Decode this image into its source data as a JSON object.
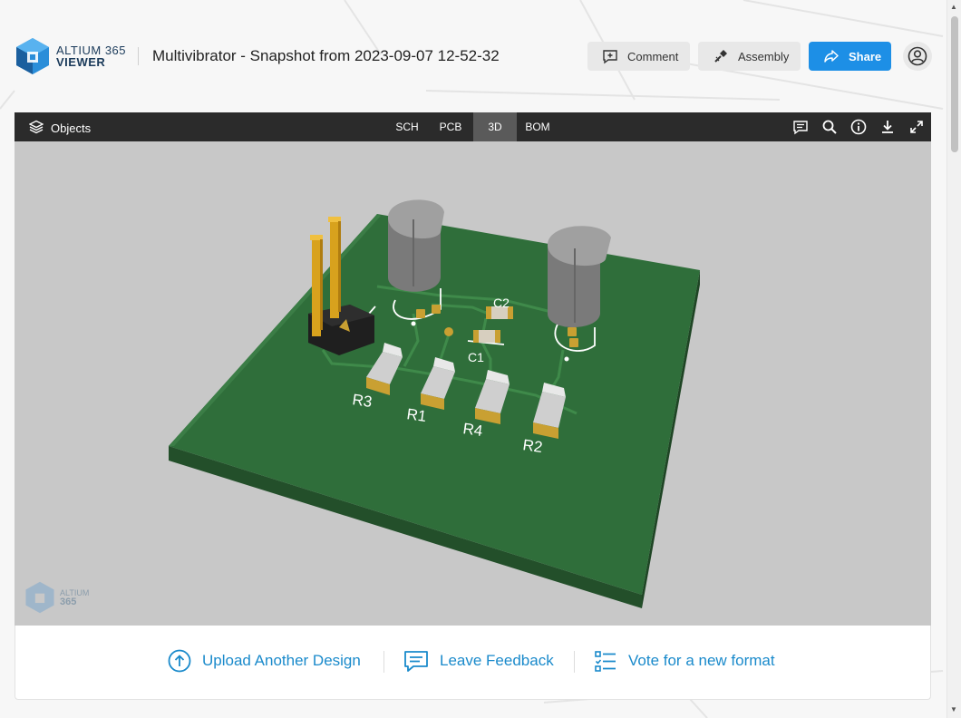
{
  "app": {
    "logo_line1": "ALTIUM 365",
    "logo_line2": "VIEWER"
  },
  "document": {
    "title": "Multivibrator - Snapshot from 2023-09-07 12-52-32"
  },
  "header": {
    "comment_label": "Comment",
    "assembly_label": "Assembly",
    "share_label": "Share"
  },
  "viewer": {
    "objects_label": "Objects",
    "tabs": [
      {
        "label": "SCH",
        "active": false
      },
      {
        "label": "PCB",
        "active": false
      },
      {
        "label": "3D",
        "active": true
      },
      {
        "label": "BOM",
        "active": false
      }
    ],
    "tool_icons": [
      "comments-icon",
      "search-icon",
      "info-icon",
      "download-icon",
      "fullscreen-icon"
    ],
    "watermark_line1": "ALTIUM",
    "watermark_line2": "365"
  },
  "board": {
    "labels": [
      "C2",
      "C1",
      "R3",
      "R1",
      "R4",
      "R2"
    ],
    "colors": {
      "board": "#2f6e3a",
      "board_side": "#234f2a",
      "pad": "#c9a032",
      "silk": "#ffffff",
      "background": "#c8c8c8"
    }
  },
  "footer": {
    "upload_label": "Upload Another Design",
    "feedback_label": "Leave Feedback",
    "vote_label": "Vote for a new format"
  },
  "colors": {
    "accent": "#1d8fe6",
    "link": "#1a8acb",
    "toolbar": "#2b2b2b"
  }
}
